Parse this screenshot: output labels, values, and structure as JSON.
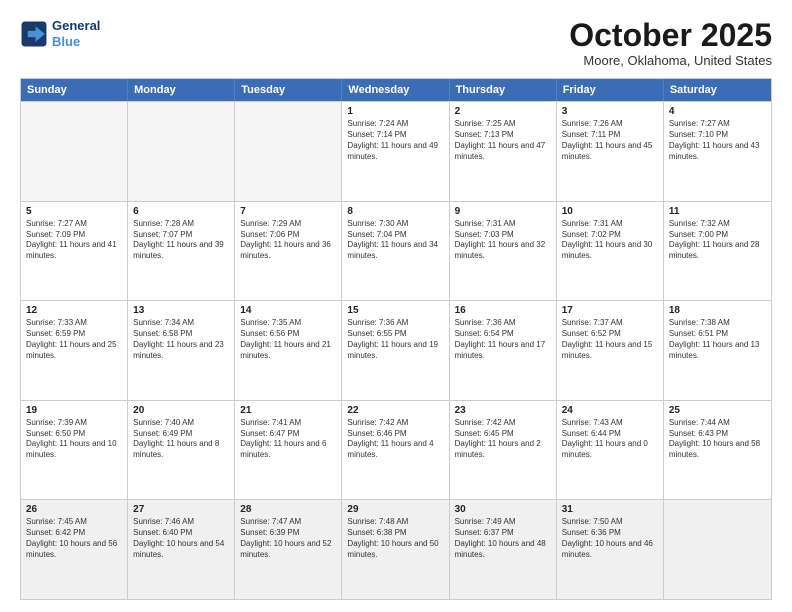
{
  "header": {
    "logo_line1": "General",
    "logo_line2": "Blue",
    "month_title": "October 2025",
    "location": "Moore, Oklahoma, United States"
  },
  "day_headers": [
    "Sunday",
    "Monday",
    "Tuesday",
    "Wednesday",
    "Thursday",
    "Friday",
    "Saturday"
  ],
  "weeks": [
    [
      {
        "day": "",
        "empty": true
      },
      {
        "day": "",
        "empty": true
      },
      {
        "day": "",
        "empty": true
      },
      {
        "day": "1",
        "sunrise": "7:24 AM",
        "sunset": "7:14 PM",
        "daylight": "11 hours and 49 minutes."
      },
      {
        "day": "2",
        "sunrise": "7:25 AM",
        "sunset": "7:13 PM",
        "daylight": "11 hours and 47 minutes."
      },
      {
        "day": "3",
        "sunrise": "7:26 AM",
        "sunset": "7:11 PM",
        "daylight": "11 hours and 45 minutes."
      },
      {
        "day": "4",
        "sunrise": "7:27 AM",
        "sunset": "7:10 PM",
        "daylight": "11 hours and 43 minutes."
      }
    ],
    [
      {
        "day": "5",
        "sunrise": "7:27 AM",
        "sunset": "7:09 PM",
        "daylight": "11 hours and 41 minutes."
      },
      {
        "day": "6",
        "sunrise": "7:28 AM",
        "sunset": "7:07 PM",
        "daylight": "11 hours and 39 minutes."
      },
      {
        "day": "7",
        "sunrise": "7:29 AM",
        "sunset": "7:06 PM",
        "daylight": "11 hours and 36 minutes."
      },
      {
        "day": "8",
        "sunrise": "7:30 AM",
        "sunset": "7:04 PM",
        "daylight": "11 hours and 34 minutes."
      },
      {
        "day": "9",
        "sunrise": "7:31 AM",
        "sunset": "7:03 PM",
        "daylight": "11 hours and 32 minutes."
      },
      {
        "day": "10",
        "sunrise": "7:31 AM",
        "sunset": "7:02 PM",
        "daylight": "11 hours and 30 minutes."
      },
      {
        "day": "11",
        "sunrise": "7:32 AM",
        "sunset": "7:00 PM",
        "daylight": "11 hours and 28 minutes."
      }
    ],
    [
      {
        "day": "12",
        "sunrise": "7:33 AM",
        "sunset": "6:59 PM",
        "daylight": "11 hours and 25 minutes."
      },
      {
        "day": "13",
        "sunrise": "7:34 AM",
        "sunset": "6:58 PM",
        "daylight": "11 hours and 23 minutes."
      },
      {
        "day": "14",
        "sunrise": "7:35 AM",
        "sunset": "6:56 PM",
        "daylight": "11 hours and 21 minutes."
      },
      {
        "day": "15",
        "sunrise": "7:36 AM",
        "sunset": "6:55 PM",
        "daylight": "11 hours and 19 minutes."
      },
      {
        "day": "16",
        "sunrise": "7:36 AM",
        "sunset": "6:54 PM",
        "daylight": "11 hours and 17 minutes."
      },
      {
        "day": "17",
        "sunrise": "7:37 AM",
        "sunset": "6:52 PM",
        "daylight": "11 hours and 15 minutes."
      },
      {
        "day": "18",
        "sunrise": "7:38 AM",
        "sunset": "6:51 PM",
        "daylight": "11 hours and 13 minutes."
      }
    ],
    [
      {
        "day": "19",
        "sunrise": "7:39 AM",
        "sunset": "6:50 PM",
        "daylight": "11 hours and 10 minutes."
      },
      {
        "day": "20",
        "sunrise": "7:40 AM",
        "sunset": "6:49 PM",
        "daylight": "11 hours and 8 minutes."
      },
      {
        "day": "21",
        "sunrise": "7:41 AM",
        "sunset": "6:47 PM",
        "daylight": "11 hours and 6 minutes."
      },
      {
        "day": "22",
        "sunrise": "7:42 AM",
        "sunset": "6:46 PM",
        "daylight": "11 hours and 4 minutes."
      },
      {
        "day": "23",
        "sunrise": "7:42 AM",
        "sunset": "6:45 PM",
        "daylight": "11 hours and 2 minutes."
      },
      {
        "day": "24",
        "sunrise": "7:43 AM",
        "sunset": "6:44 PM",
        "daylight": "11 hours and 0 minutes."
      },
      {
        "day": "25",
        "sunrise": "7:44 AM",
        "sunset": "6:43 PM",
        "daylight": "10 hours and 58 minutes."
      }
    ],
    [
      {
        "day": "26",
        "sunrise": "7:45 AM",
        "sunset": "6:42 PM",
        "daylight": "10 hours and 56 minutes."
      },
      {
        "day": "27",
        "sunrise": "7:46 AM",
        "sunset": "6:40 PM",
        "daylight": "10 hours and 54 minutes."
      },
      {
        "day": "28",
        "sunrise": "7:47 AM",
        "sunset": "6:39 PM",
        "daylight": "10 hours and 52 minutes."
      },
      {
        "day": "29",
        "sunrise": "7:48 AM",
        "sunset": "6:38 PM",
        "daylight": "10 hours and 50 minutes."
      },
      {
        "day": "30",
        "sunrise": "7:49 AM",
        "sunset": "6:37 PM",
        "daylight": "10 hours and 48 minutes."
      },
      {
        "day": "31",
        "sunrise": "7:50 AM",
        "sunset": "6:36 PM",
        "daylight": "10 hours and 46 minutes."
      },
      {
        "day": "",
        "empty": true
      }
    ]
  ]
}
